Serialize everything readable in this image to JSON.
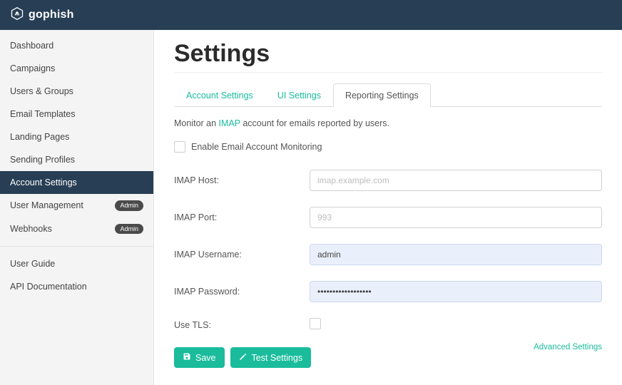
{
  "brand": {
    "name": "gophish"
  },
  "sidebar": {
    "items": [
      {
        "label": "Dashboard"
      },
      {
        "label": "Campaigns"
      },
      {
        "label": "Users & Groups"
      },
      {
        "label": "Email Templates"
      },
      {
        "label": "Landing Pages"
      },
      {
        "label": "Sending Profiles"
      },
      {
        "label": "Account Settings",
        "active": true
      },
      {
        "label": "User Management",
        "badge": "Admin"
      },
      {
        "label": "Webhooks",
        "badge": "Admin"
      }
    ],
    "help": [
      {
        "label": "User Guide"
      },
      {
        "label": "API Documentation"
      }
    ]
  },
  "page": {
    "title": "Settings"
  },
  "tabs": [
    {
      "label": "Account Settings"
    },
    {
      "label": "UI Settings"
    },
    {
      "label": "Reporting Settings",
      "active": true
    }
  ],
  "desc": {
    "prefix": "Monitor an ",
    "link": "IMAP",
    "suffix": " account for emails reported by users."
  },
  "monitor": {
    "checkbox_label": "Enable Email Account Monitoring",
    "enabled": false
  },
  "form": {
    "host": {
      "label": "IMAP Host:",
      "placeholder": "imap.example.com",
      "value": ""
    },
    "port": {
      "label": "IMAP Port:",
      "placeholder": "993",
      "value": ""
    },
    "username": {
      "label": "IMAP Username:",
      "value": "admin"
    },
    "password": {
      "label": "IMAP Password:",
      "value": "••••••••••••••••••"
    },
    "tls": {
      "label": "Use TLS:",
      "checked": false
    }
  },
  "advanced_link": "Advanced Settings",
  "buttons": {
    "save": "Save",
    "test": "Test Settings"
  }
}
